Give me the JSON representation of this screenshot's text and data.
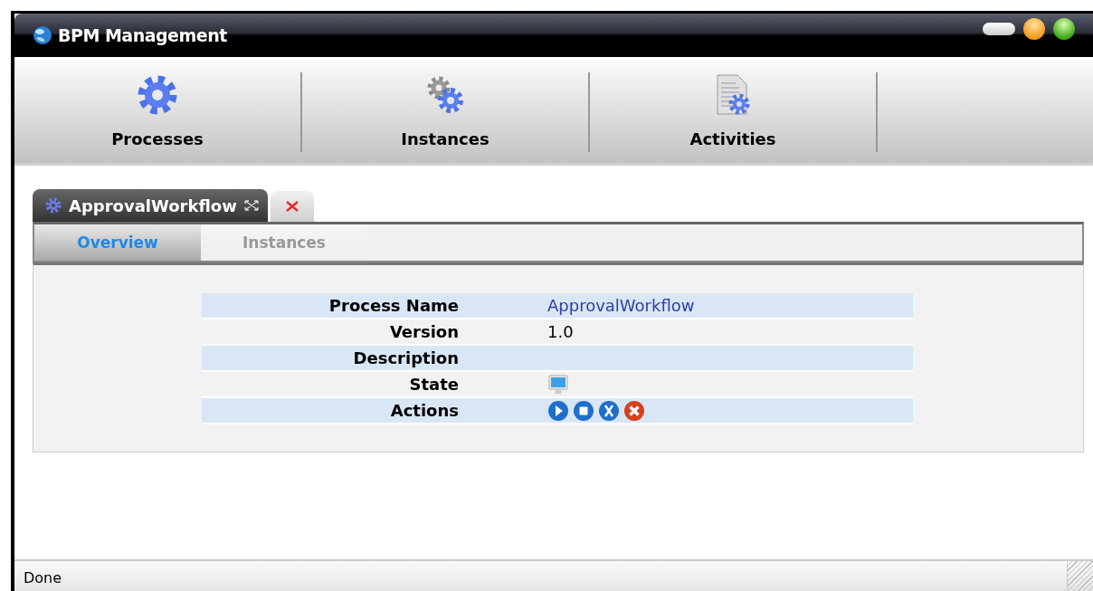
{
  "window": {
    "title": "BPM Management"
  },
  "toolbar": [
    {
      "label": "Processes",
      "kind": "gear"
    },
    {
      "label": "Instances",
      "kind": "gears"
    },
    {
      "label": "Activities",
      "kind": "document"
    }
  ],
  "document_tabs": [
    {
      "label": "ApprovalWorkflow",
      "selected": true
    }
  ],
  "subtabs": [
    {
      "label": "Overview",
      "selected": true
    },
    {
      "label": "Instances",
      "selected": false
    }
  ],
  "properties": [
    {
      "label": "Process Name",
      "kind": "link",
      "value": "ApprovalWorkflow"
    },
    {
      "label": "Version",
      "kind": "text",
      "value": "1.0"
    },
    {
      "label": "Description",
      "kind": "text"
    },
    {
      "label": "State",
      "kind": "state"
    },
    {
      "label": "Actions",
      "kind": "actions"
    }
  ],
  "status_bar": {
    "text": "Done"
  }
}
